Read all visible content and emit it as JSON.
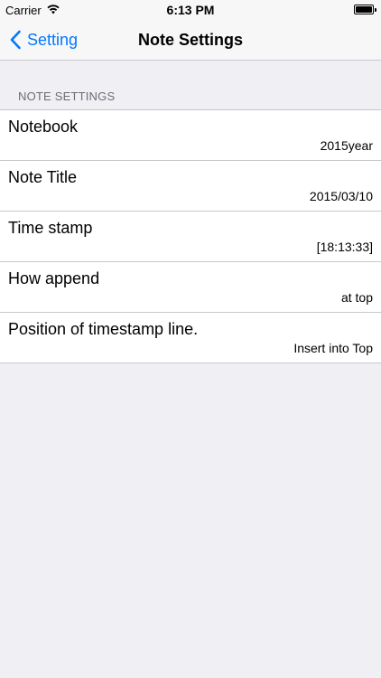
{
  "status_bar": {
    "carrier": "Carrier",
    "time": "6:13 PM"
  },
  "nav": {
    "back_label": "Setting",
    "title": "Note Settings"
  },
  "section": {
    "header": "NOTE SETTINGS"
  },
  "rows": [
    {
      "title": "Notebook",
      "value": "2015year"
    },
    {
      "title": "Note Title",
      "value": "2015/03/10"
    },
    {
      "title": "Time stamp",
      "value": "[18:13:33]"
    },
    {
      "title": "How append",
      "value": "at top"
    },
    {
      "title": "Position of timestamp line.",
      "value": "Insert into Top"
    }
  ],
  "colors": {
    "accent": "#0079ff",
    "background": "#efeff4",
    "separator": "#c8c7cc",
    "section_header": "#6d6d72"
  }
}
